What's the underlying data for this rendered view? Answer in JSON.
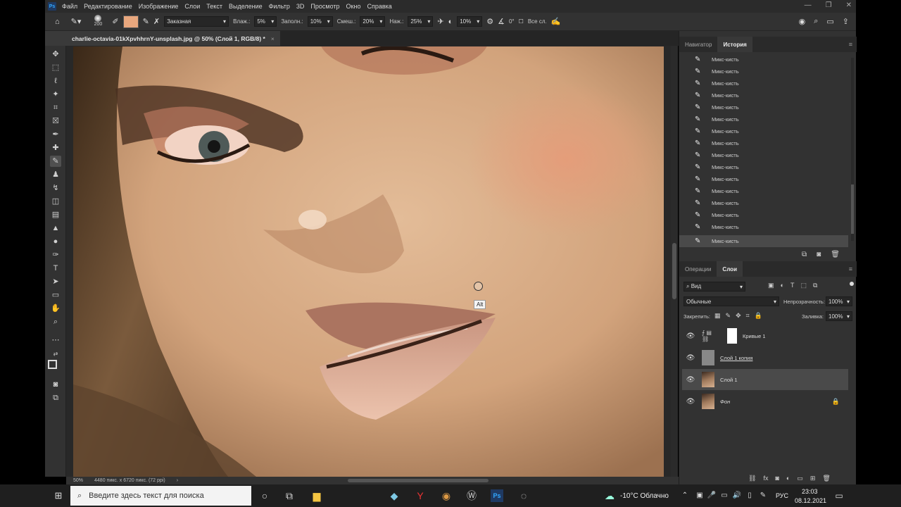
{
  "app": {
    "logo": "Ps"
  },
  "menu": [
    "Файл",
    "Редактирование",
    "Изображение",
    "Слои",
    "Текст",
    "Выделение",
    "Фильтр",
    "3D",
    "Просмотр",
    "Окно",
    "Справка"
  ],
  "options": {
    "brush_size": "200",
    "preset": "Заказная",
    "wet_label": "Влаж.:",
    "wet_value": "5%",
    "load_label": "Заполн.:",
    "load_value": "10%",
    "mix_label": "Смеш.:",
    "mix_value": "20%",
    "flow_label": "Наж.:",
    "flow_value": "25%",
    "smoothing_value": "10%",
    "angle_value": "0°",
    "all_layers_label": "Все сл.",
    "swatch_color": "#e8a77e"
  },
  "document": {
    "tab_title": "charlie-octavia-01kXpvhhrnY-unsplash.jpg @ 50% (Слой 1, RGB/8) *",
    "close": "×"
  },
  "canvas": {
    "cursor_tooltip": "Alt"
  },
  "status": {
    "zoom": "50%",
    "info": "4480 пикс. x 6720 пикс. (72 ppi)",
    "arrow": "›"
  },
  "history_panel": {
    "tabs": [
      "Навигатор",
      "История"
    ],
    "active_tab": "История",
    "items": [
      "Микс-кисть",
      "Микс-кисть",
      "Микс-кисть",
      "Микс-кисть",
      "Микс-кисть",
      "Микс-кисть",
      "Микс-кисть",
      "Микс-кисть",
      "Микс-кисть",
      "Микс-кисть",
      "Микс-кисть",
      "Микс-кисть",
      "Микс-кисть",
      "Микс-кисть",
      "Микс-кисть",
      "Микс-кисть"
    ]
  },
  "layers_panel": {
    "tabs": [
      "Операции",
      "Слои"
    ],
    "active_tab": "Слои",
    "filter": "Вид",
    "blend_mode": "Обычные",
    "opacity_label": "Непрозрачность:",
    "opacity_value": "100%",
    "lock_label": "Закрепить:",
    "fill_label": "Заливка:",
    "fill_value": "100%",
    "layers": [
      {
        "name": "Кривые 1"
      },
      {
        "name": "Слой 1 копия"
      },
      {
        "name": "Слой 1"
      },
      {
        "name": "Фон"
      }
    ]
  },
  "taskbar": {
    "search_placeholder": "Введите здесь текст для поиска",
    "weather": "-10°C Облачно",
    "lang": "РУС",
    "time": "23:03",
    "date": "08.12.2021"
  }
}
